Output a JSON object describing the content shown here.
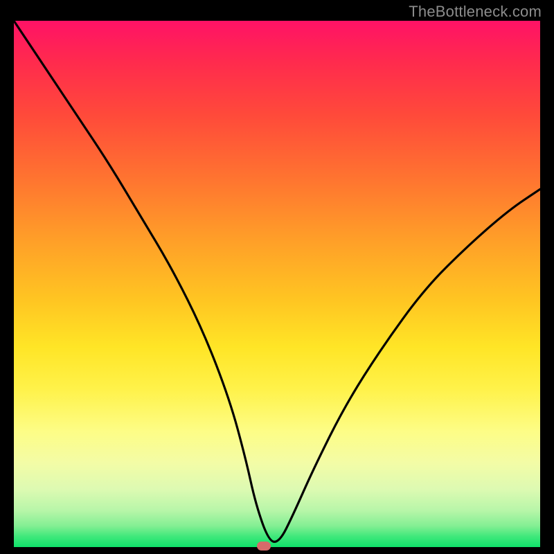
{
  "attribution": "TheBottleneck.com",
  "marker": {
    "x_pct": 47.5,
    "y_pct": 100
  },
  "chart_data": {
    "type": "line",
    "title": "",
    "xlabel": "",
    "ylabel": "",
    "xlim": [
      0,
      100
    ],
    "ylim": [
      0,
      100
    ],
    "series": [
      {
        "name": "bottleneck-curve",
        "x": [
          0,
          6,
          12,
          18,
          24,
          30,
          36,
          41,
          44,
          46,
          48.5,
          50.5,
          53,
          57,
          63,
          70,
          78,
          86,
          94,
          100
        ],
        "values": [
          100,
          91,
          82,
          73,
          63,
          53,
          41,
          28,
          17,
          8,
          1,
          1,
          6,
          15,
          27,
          38,
          49,
          57,
          64,
          68
        ]
      }
    ],
    "marker": {
      "x": 47.5,
      "y": 0
    },
    "background_gradient": {
      "stops": [
        {
          "pos": 0,
          "color": "#ff1266"
        },
        {
          "pos": 8,
          "color": "#ff2b4d"
        },
        {
          "pos": 18,
          "color": "#ff4a3a"
        },
        {
          "pos": 30,
          "color": "#ff7430"
        },
        {
          "pos": 42,
          "color": "#ffa028"
        },
        {
          "pos": 53,
          "color": "#ffc522"
        },
        {
          "pos": 62,
          "color": "#ffe526"
        },
        {
          "pos": 70,
          "color": "#fff24a"
        },
        {
          "pos": 78,
          "color": "#fdfd86"
        },
        {
          "pos": 84,
          "color": "#f3fca6"
        },
        {
          "pos": 89,
          "color": "#ddfab2"
        },
        {
          "pos": 93,
          "color": "#b8f6a9"
        },
        {
          "pos": 96,
          "color": "#83ef93"
        },
        {
          "pos": 98,
          "color": "#3fe87b"
        },
        {
          "pos": 100,
          "color": "#0fe26a"
        }
      ]
    }
  }
}
